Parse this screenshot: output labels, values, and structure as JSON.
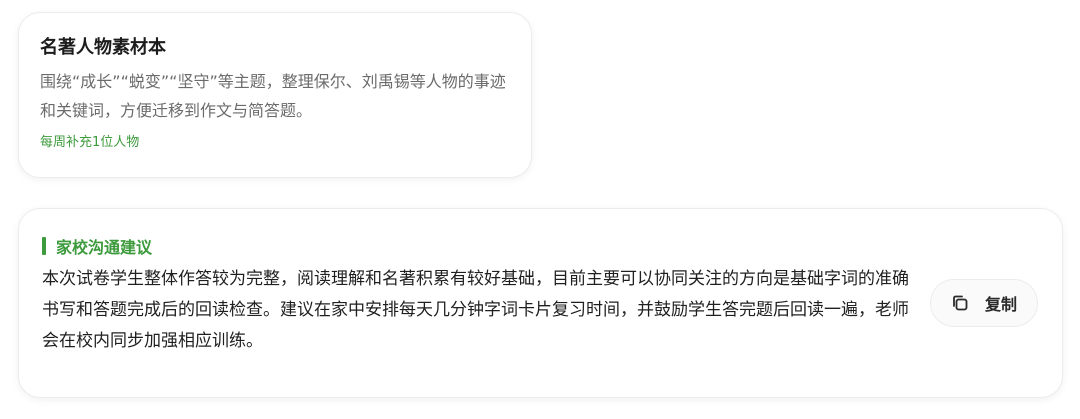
{
  "material_card": {
    "title": "名著人物素材本",
    "description": "围绕“成长”“蜕变”“坚守”等主题，整理保尔、刘禹锡等人物的事迹和关键词，方便迁移到作文与简答题。",
    "tag": "每周补充1位人物"
  },
  "advice_card": {
    "section_title": "家校沟通建议",
    "body": "本次试卷学生整体作答较为完整，阅读理解和名著积累有较好基础，目前主要可以协同关注的方向是基础字词的准确书写和答题完成后的回读检查。建议在家中安排每天几分钟字词卡片复习时间，并鼓励学生答完题后回读一遍，老师会在校内同步加强相应训练。",
    "copy_button": {
      "label": "复制",
      "icon": "copy-icon"
    }
  },
  "colors": {
    "accent": "#3d9a3d",
    "muted_text": "#6b6b6b",
    "border": "#ececec"
  }
}
